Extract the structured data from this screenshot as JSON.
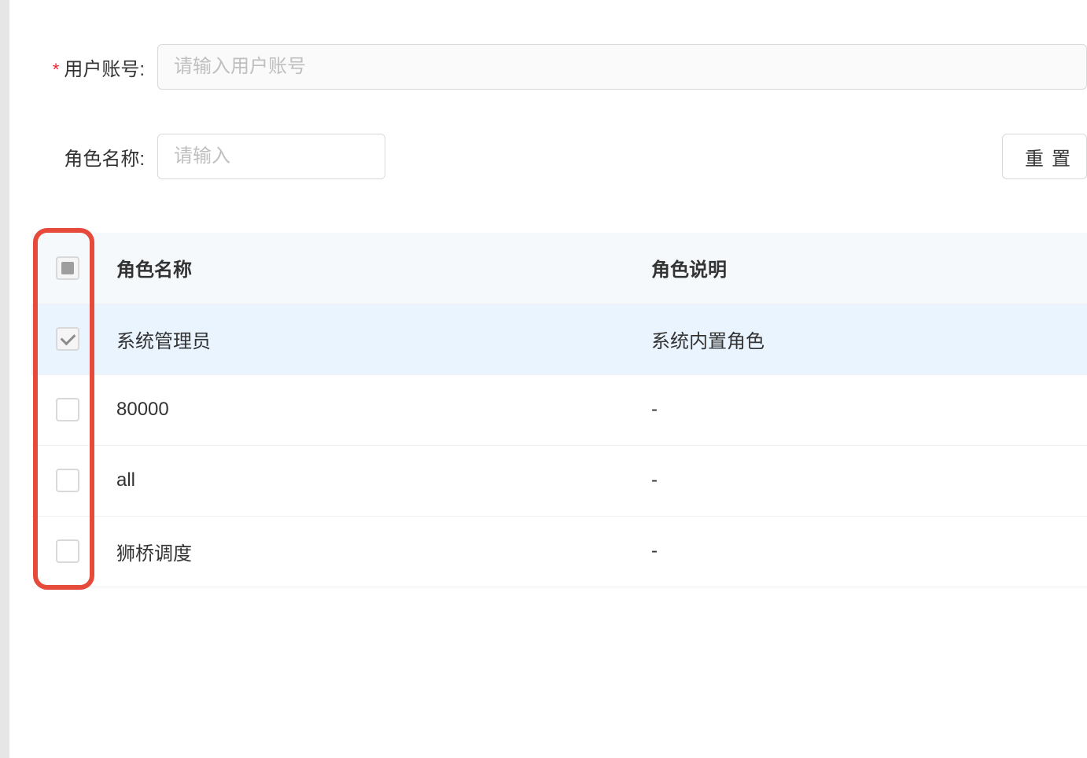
{
  "form": {
    "account_label": "用户账号:",
    "account_placeholder": "请输入用户账号",
    "role_name_label": "角色名称:",
    "role_name_placeholder": "请输入",
    "reset_label": "重置"
  },
  "table": {
    "headers": {
      "role_name": "角色名称",
      "role_desc": "角色说明"
    },
    "rows": [
      {
        "name": "系统管理员",
        "desc": "系统内置角色",
        "checked": true
      },
      {
        "name": "80000",
        "desc": "-",
        "checked": false
      },
      {
        "name": "all",
        "desc": "-",
        "checked": false
      },
      {
        "name": "狮桥调度",
        "desc": "-",
        "checked": false
      }
    ]
  }
}
